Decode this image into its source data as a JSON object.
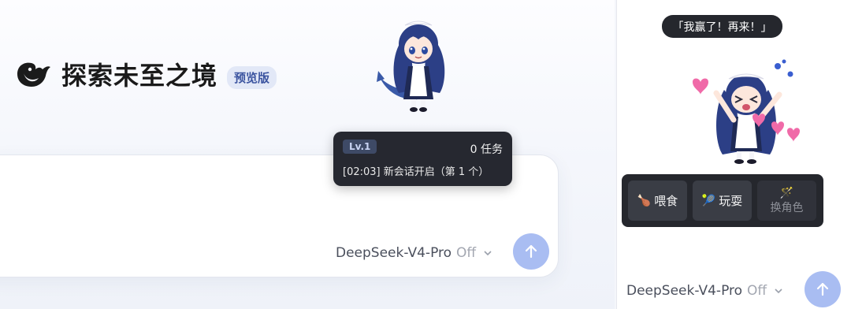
{
  "main": {
    "title": "探索未至之境",
    "badge": "预览版",
    "logo_icon": "deepseek-whale-icon",
    "status_card": {
      "level": "Lv.1",
      "tasks": "0 任务",
      "log": "[02:03] 新会话开启（第 1 个）"
    },
    "composer": {
      "model": "DeepSeek-V4-Pro",
      "mode": "Off",
      "send_icon": "arrow-up-icon"
    }
  },
  "side": {
    "speech": "「我赢了！再来！」",
    "actions": [
      {
        "label": "喂食",
        "icon": "drumstick-icon"
      },
      {
        "label": "玩耍",
        "icon": "ball-icon"
      },
      {
        "label": "换角色",
        "icon": "swap-icon"
      }
    ],
    "composer": {
      "model": "DeepSeek-V4-Pro",
      "mode": "Off",
      "send_icon": "arrow-up-icon"
    }
  },
  "colors": {
    "accent": "#a9bdf2",
    "dark_popup": "#262830",
    "badge_bg": "#e2e8f7",
    "badge_text": "#3b54a0",
    "hair": "#2c3f86"
  }
}
